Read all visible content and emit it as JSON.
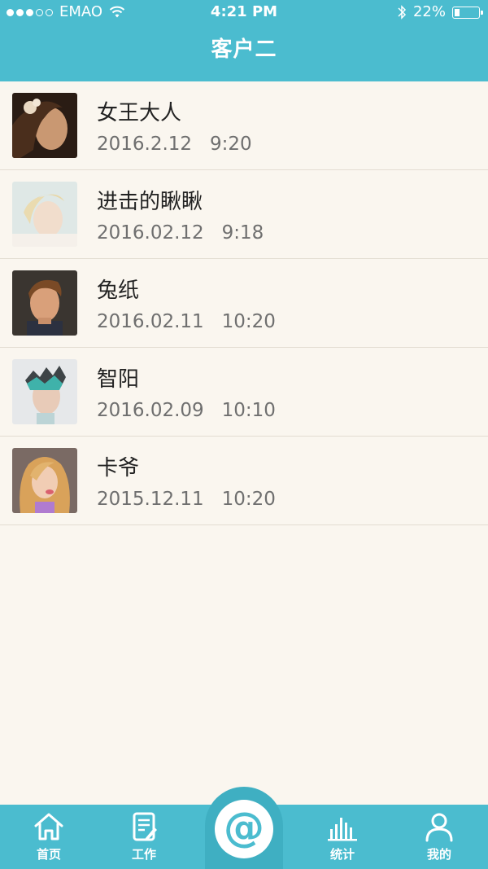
{
  "status": {
    "carrier": "EMAO",
    "time": "4:21 PM",
    "battery": "22%",
    "battery_level": 0.22
  },
  "header": {
    "title": "客户二"
  },
  "customers": [
    {
      "name": "女王大人",
      "time": "2016.2.12   9:20"
    },
    {
      "name": "进击的瞅瞅",
      "time": "2016.02.12   9:18"
    },
    {
      "name": "兔纸",
      "time": "2016.02.11   10:20"
    },
    {
      "name": "智阳",
      "time": "2016.02.09   10:10"
    },
    {
      "name": "卡爷",
      "time": "2015.12.11   10:20"
    }
  ],
  "tabs": {
    "home": "首页",
    "work": "工作",
    "center": "@",
    "stats": "统计",
    "mine": "我的"
  },
  "colors": {
    "primary": "#4bbccf",
    "background": "#faf6ef"
  }
}
